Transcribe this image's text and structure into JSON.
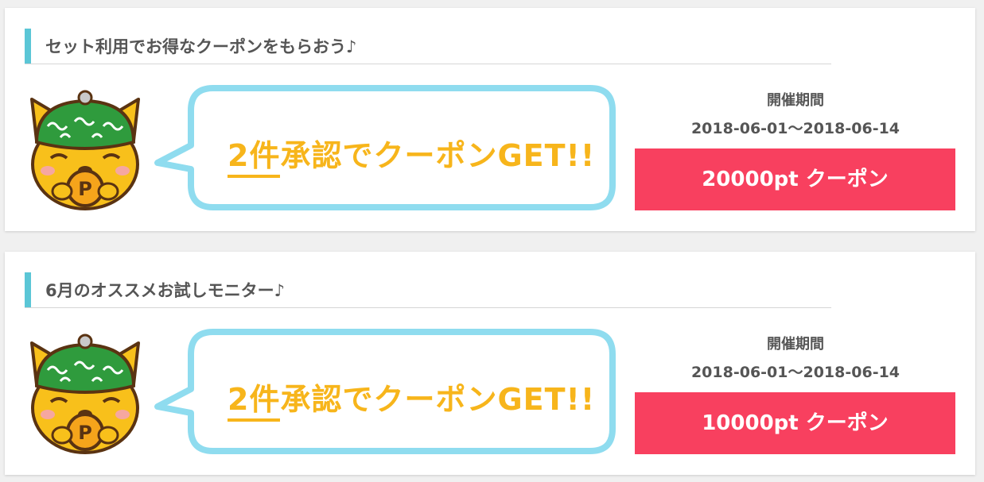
{
  "campaigns": [
    {
      "title": "セット利用でお得なクーポンをもらおう♪",
      "bubble_number": "2件",
      "bubble_text": "承認でクーポンGET!!",
      "period_label": "開催期間",
      "period_dates": "2018-06-01〜2018-06-14",
      "coupon_label": "20000pt クーポン"
    },
    {
      "title": "6月のオススメお試しモニター♪",
      "bubble_number": "2件",
      "bubble_text": "承認でクーポンGET!!",
      "period_label": "開催期間",
      "period_dates": "2018-06-01〜2018-06-14",
      "coupon_label": "10000pt クーポン"
    }
  ],
  "colors": {
    "accent_bar": "#5bc6d6",
    "bubble_border": "#8fdcef",
    "bubble_text": "#f7b51b",
    "coupon_button": "#f8405f",
    "text": "#555555"
  },
  "icons": {
    "mascot": "cat-mascot-icon"
  }
}
